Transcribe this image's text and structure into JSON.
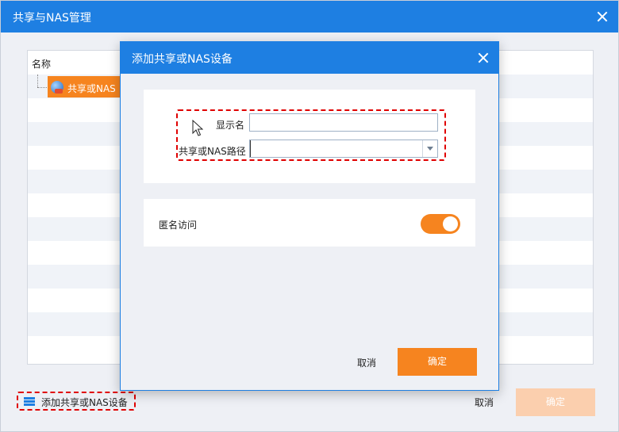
{
  "outer_window": {
    "title": "共享与NAS管理",
    "list_header": "名称",
    "tree_node_label": "共享或NAS",
    "add_device_link": "添加共享或NAS设备",
    "cancel_label": "取消",
    "ok_label": "确定"
  },
  "dialog": {
    "title": "添加共享或NAS设备",
    "display_name_label": "显示名",
    "display_name_value": "",
    "path_label": "共享或NAS路径",
    "path_value": "",
    "anonymous_access_label": "匿名访问",
    "anonymous_access_on": true,
    "cancel_label": "取消",
    "ok_label": "确定"
  },
  "colors": {
    "title_bar": "#1e7fe2",
    "accent_orange": "#f6841f",
    "disabled_orange": "#fbcfae",
    "highlight_red": "#e00000"
  },
  "icons": [
    "close-icon",
    "network-share-icon",
    "device-stack-icon",
    "dropdown-arrow-icon",
    "mouse-cursor-icon"
  ]
}
